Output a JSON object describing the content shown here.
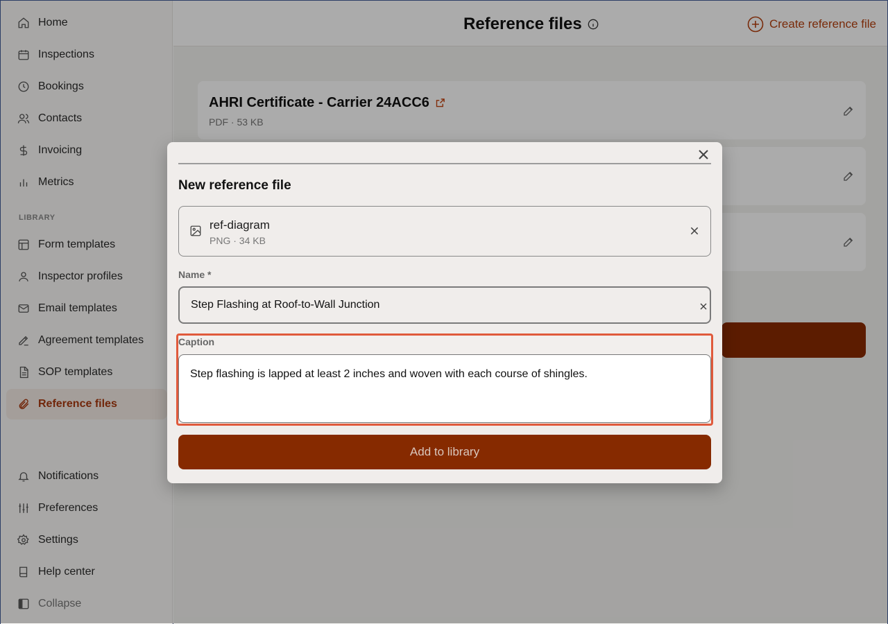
{
  "sidebar": {
    "items": [
      {
        "label": "Home",
        "icon": "home-icon"
      },
      {
        "label": "Inspections",
        "icon": "calendar-icon"
      },
      {
        "label": "Bookings",
        "icon": "clock-icon"
      },
      {
        "label": "Contacts",
        "icon": "users-icon"
      },
      {
        "label": "Invoicing",
        "icon": "dollar-icon"
      },
      {
        "label": "Metrics",
        "icon": "bar-chart-icon"
      }
    ],
    "section_label": "LIBRARY",
    "library_items": [
      {
        "label": "Form templates",
        "icon": "layout-icon"
      },
      {
        "label": "Inspector profiles",
        "icon": "user-icon"
      },
      {
        "label": "Email templates",
        "icon": "mail-icon"
      },
      {
        "label": "Agreement templates",
        "icon": "signature-icon"
      },
      {
        "label": "SOP templates",
        "icon": "document-icon"
      },
      {
        "label": "Reference files",
        "icon": "paperclip-icon",
        "active": true
      }
    ],
    "bottom_items": [
      {
        "label": "Notifications",
        "icon": "bell-icon"
      },
      {
        "label": "Preferences",
        "icon": "sliders-icon"
      },
      {
        "label": "Settings",
        "icon": "gear-icon"
      },
      {
        "label": "Help center",
        "icon": "book-icon"
      },
      {
        "label": "Collapse",
        "icon": "collapse-icon"
      }
    ]
  },
  "header": {
    "title": "Reference files",
    "create_label": "Create reference file"
  },
  "cards": [
    {
      "title": "AHRI Certificate - Carrier 24ACC6",
      "meta": "PDF · 53 KB"
    }
  ],
  "modal": {
    "title": "New reference file",
    "file": {
      "name": "ref-diagram",
      "meta": "PNG · 34 KB"
    },
    "name_label": "Name *",
    "name_value": "Step Flashing at Roof-to-Wall Junction",
    "caption_label": "Caption",
    "caption_value": "Step flashing is lapped at least 2 inches and woven with each course of shingles.",
    "submit_label": "Add to library"
  },
  "colors": {
    "accent": "#b5400f",
    "primary_button": "#862a00",
    "highlight": "#e05a3c"
  }
}
